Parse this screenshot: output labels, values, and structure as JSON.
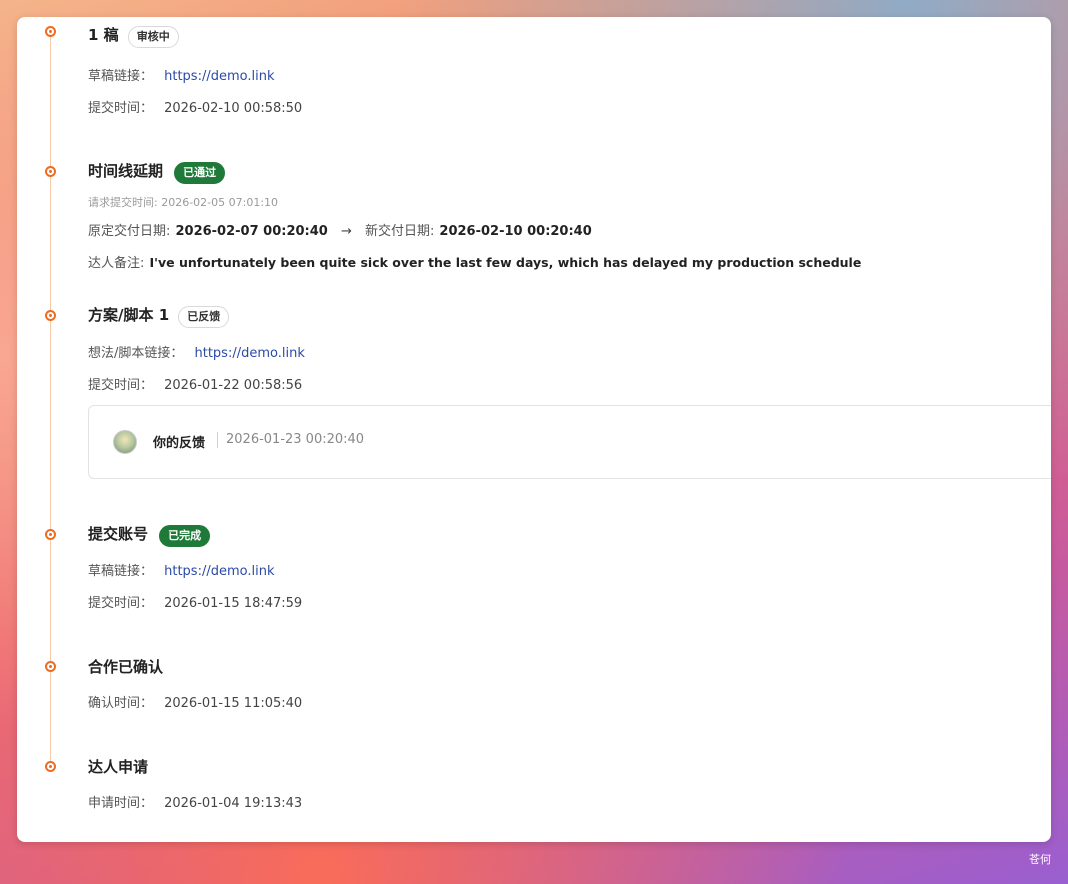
{
  "timeline": {
    "draft1": {
      "title": "1 稿",
      "badge": "审核中",
      "link_label": "草稿链接：",
      "link": "https://demo.link",
      "time_label": "提交时间：",
      "time": "2026-02-10 00:58:50"
    },
    "extension": {
      "title": "时间线延期",
      "badge": "已通过",
      "request_time": "请求提交时间: 2026-02-05 07:01:10",
      "orig_label": "原定交付日期:",
      "orig_date": "2026-02-07 00:20:40",
      "arrow": "→",
      "new_label": "新交付日期:",
      "new_date": "2026-02-10 00:20:40",
      "note_label": "达人备注:",
      "note": "I've unfortunately been quite sick over the last few days, which has delayed my production schedule"
    },
    "script1": {
      "title": "方案/脚本 1",
      "badge": "已反馈",
      "link_label": "想法/脚本链接：",
      "link": "https://demo.link",
      "time_label": "提交时间：",
      "time": "2026-01-22 00:58:56",
      "feedback": {
        "label": "你的反馈",
        "time": "2026-01-23 00:20:40"
      }
    },
    "account": {
      "title": "提交账号",
      "badge": "已完成",
      "link_label": "草稿链接：",
      "link": "https://demo.link",
      "time_label": "提交时间：",
      "time": "2026-01-15 18:47:59"
    },
    "confirmed": {
      "title": "合作已确认",
      "time_label": "确认时间：",
      "time": "2026-01-15 11:05:40"
    },
    "apply": {
      "title": "达人申请",
      "time_label": "申请时间：",
      "time": "2026-01-04 19:13:43"
    }
  },
  "watermark": "苍何",
  "colors": {
    "accent": "#f06a1f",
    "green_badge": "#1f7a3a",
    "link": "#2b4aa8"
  }
}
